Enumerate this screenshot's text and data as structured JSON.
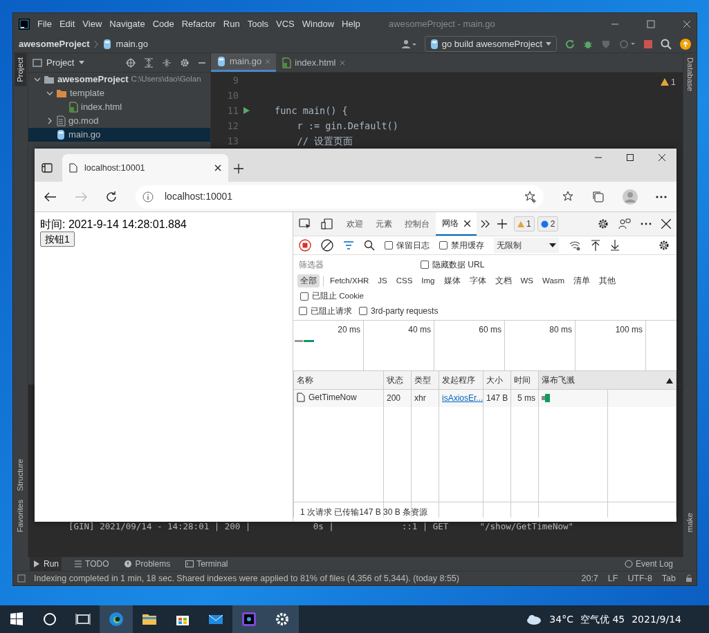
{
  "ide": {
    "menu": [
      "File",
      "Edit",
      "View",
      "Navigate",
      "Code",
      "Refactor",
      "Run",
      "Tools",
      "VCS",
      "Window",
      "Help"
    ],
    "title": "awesomeProject - main.go",
    "breadcrumb": [
      "awesomeProject",
      "main.go"
    ],
    "run_config": "go build awesomeProject",
    "left_tools": [
      {
        "label": "Project",
        "selected": true
      },
      {
        "label": "Structure",
        "selected": false
      },
      {
        "label": "Favorites",
        "selected": false
      }
    ],
    "right_tools": [
      "Database",
      "make"
    ],
    "project_title": "Project",
    "tree": [
      {
        "label": "awesomeProject",
        "path": "C:\\Users\\dao\\Golan",
        "kind": "project",
        "expanded": true,
        "selected": false,
        "children": [
          {
            "label": "template",
            "kind": "folder",
            "expanded": true,
            "selected": false,
            "children": [
              {
                "label": "index.html",
                "kind": "html",
                "selected": false
              }
            ]
          },
          {
            "label": "go.mod",
            "kind": "mod",
            "expanded": false,
            "selected": false
          },
          {
            "label": "main.go",
            "kind": "go",
            "selected": true
          }
        ]
      }
    ],
    "editor_tabs": [
      {
        "label": "main.go",
        "kind": "go",
        "selected": true
      },
      {
        "label": "index.html",
        "kind": "html",
        "selected": false
      }
    ],
    "warning_count": "1",
    "code_lines": [
      {
        "number": "9"
      },
      {
        "number": "10"
      },
      {
        "number": "11",
        "code": "func main() {",
        "runnable": true
      },
      {
        "number": "12",
        "code": "    r := gin.Default()"
      },
      {
        "number": "13",
        "code": "    // 设置页面"
      }
    ],
    "console_line": "[GIN] 2021/09/14 - 14:28:01 | 200 |            0s |             ::1 | GET      \"/show/GetTimeNow\"",
    "bottom_tabs": [
      {
        "label": "Run",
        "selected": true
      },
      {
        "label": "TODO",
        "selected": false
      },
      {
        "label": "Problems",
        "selected": false
      },
      {
        "label": "Terminal",
        "selected": false
      }
    ],
    "event_log": "Event Log",
    "status": "Indexing completed in 1 min, 18 sec. Shared indexes were applied to 81% of files (4,356 of 5,344). (today 8:55)",
    "status_right": [
      "20:7",
      "LF",
      "UTF-8",
      "Tab"
    ]
  },
  "browser": {
    "tab_title": "localhost:10001",
    "address": "localhost:10001",
    "page": {
      "time_text": "时间: 2021-9-14 14:28:01.884",
      "button": "按钮1"
    },
    "devtools": {
      "tabs": [
        {
          "label": "欢迎",
          "selected": false
        },
        {
          "label": "元素",
          "selected": false
        },
        {
          "label": "控制台",
          "selected": false
        },
        {
          "label": "网络",
          "selected": true
        }
      ],
      "warnings": "1",
      "messages": "2",
      "toolbar_checks": [
        {
          "label": "保留日志",
          "checked": false
        },
        {
          "label": "禁用缓存",
          "checked": false
        }
      ],
      "throttle": "无限制",
      "filter_placeholder": "筛选器",
      "hide_data_urls": {
        "label": "隐藏数据 URL",
        "checked": false
      },
      "type_filters": [
        {
          "label": "全部",
          "selected": true
        },
        {
          "label": "Fetch/XHR",
          "selected": false
        },
        {
          "label": "JS",
          "selected": false
        },
        {
          "label": "CSS",
          "selected": false
        },
        {
          "label": "Img",
          "selected": false
        },
        {
          "label": "媒体",
          "selected": false
        },
        {
          "label": "字体",
          "selected": false
        },
        {
          "label": "文档",
          "selected": false
        },
        {
          "label": "WS",
          "selected": false
        },
        {
          "label": "Wasm",
          "selected": false
        },
        {
          "label": "清单",
          "selected": false
        },
        {
          "label": "其他",
          "selected": false
        }
      ],
      "blocked_cookies": {
        "label": "已阻止 Cookie",
        "checked": false
      },
      "more_checks": [
        {
          "label": "已阻止请求",
          "checked": false
        },
        {
          "label": "3rd-party requests",
          "checked": false
        }
      ],
      "timeline_ticks": [
        "20 ms",
        "40 ms",
        "60 ms",
        "80 ms",
        "100 ms"
      ],
      "table": {
        "columns": [
          "名称",
          "状态",
          "类型",
          "发起程序",
          "大小",
          "时间",
          "瀑布飞溅"
        ],
        "rows": [
          {
            "name": "GetTimeNow",
            "status": "200",
            "type": "xhr",
            "initiator": "isAxiosEr...",
            "size": "147 B",
            "time": "5 ms"
          }
        ]
      },
      "summary": "1 次请求  已传输147 B  30 B 条资源"
    }
  },
  "taskbar": {
    "weather": "34°C",
    "air": "空气优 45",
    "date": "2021/9/14"
  }
}
